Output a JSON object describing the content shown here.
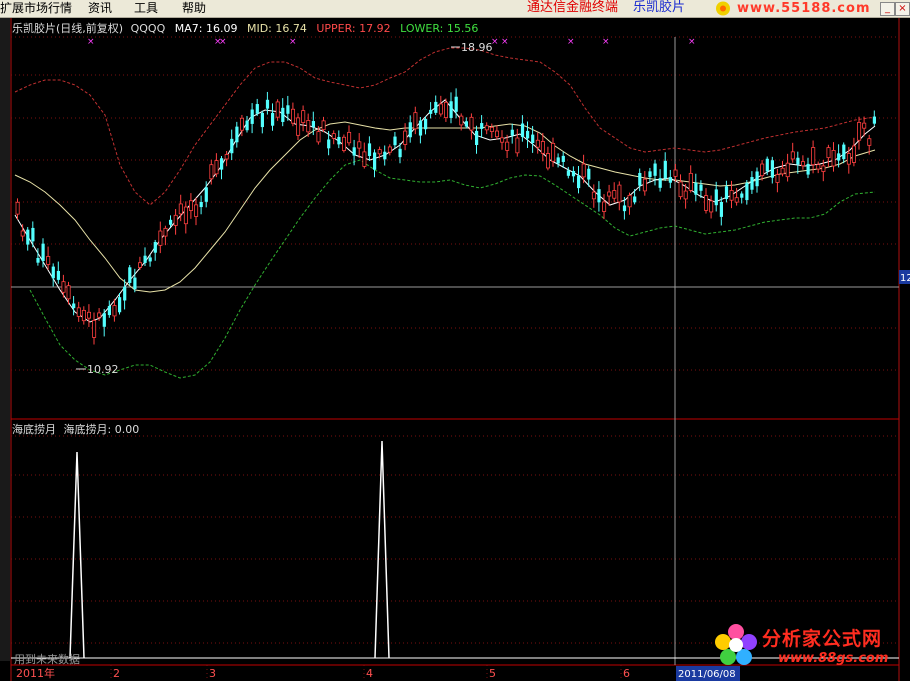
{
  "menu": {
    "items": [
      "扩展市场行情",
      "资讯",
      "工具",
      "帮助"
    ],
    "brand_main": "通达信金融终端",
    "brand_stock": "乐凯胶片",
    "logo_url": "www.55188.com"
  },
  "price_panel": {
    "stock_label": "乐凯胶片(日线,前复权)",
    "qqqq": "QQQQ",
    "ma7_label": "MA7: 16.09",
    "mid_label": "MID: 16.74",
    "upper_label": "UPPER: 17.92",
    "lower_label": "LOWER: 15.56",
    "high_marker": "18.96",
    "low_marker": "10.92",
    "right_axis_value": "12"
  },
  "indicator_panel": {
    "name": "海底捞月",
    "value_label": "海底捞月: 0.00"
  },
  "status": {
    "text": "用到未来数据"
  },
  "x_axis": {
    "labels": [
      "2011年",
      "2",
      "3",
      "4",
      "5",
      "6",
      "2011/06/08"
    ]
  },
  "watermark": {
    "title": "分析家公式网",
    "url": "www.88gs.com"
  },
  "colors": {
    "up_candle": "#ff4040",
    "down_candle": "#54ffff",
    "ma_line": "#ffffff",
    "mid_line": "#e8e2a8",
    "upper_band": "#c03030",
    "lower_band": "#30b030",
    "grid": "#8a1010",
    "separator": "#c00000"
  },
  "chart_data": {
    "type": "line",
    "x": [
      "2011-01",
      "2011-02",
      "2011-03",
      "2011-04",
      "2011-05",
      "2011-06"
    ],
    "series": [
      {
        "name": "MA7",
        "values": [
          14.8,
          13.2,
          15.9,
          16.6,
          16.3,
          16.09
        ]
      },
      {
        "name": "MID",
        "values": [
          14.6,
          13.4,
          15.5,
          16.4,
          16.5,
          16.74
        ]
      },
      {
        "name": "UPPER",
        "values": [
          17.3,
          15.5,
          18.2,
          18.3,
          17.9,
          17.92
        ]
      },
      {
        "name": "LOWER",
        "values": [
          12.5,
          11.1,
          13.0,
          15.3,
          15.2,
          15.56
        ]
      }
    ],
    "annotations": [
      "18.96",
      "10.92"
    ],
    "signal_series": {
      "name": "海底捞月",
      "spikes": 2,
      "current_value": 0.0
    }
  }
}
